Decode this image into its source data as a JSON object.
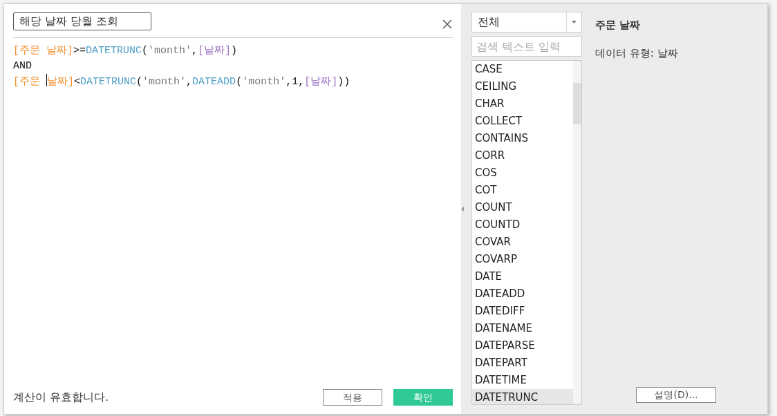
{
  "calc_name": {
    "value": "해당 날짜 당월 조회"
  },
  "formula_lines": [
    [
      {
        "kind": "field",
        "text": "[주문 날짜]"
      },
      {
        "kind": "plain",
        "text": ">="
      },
      {
        "kind": "func",
        "text": "DATETRUNC"
      },
      {
        "kind": "plain",
        "text": "("
      },
      {
        "kind": "string",
        "text": "'month'"
      },
      {
        "kind": "plain",
        "text": ","
      },
      {
        "kind": "param",
        "text": "[날짜]"
      },
      {
        "kind": "plain",
        "text": ")"
      }
    ],
    [
      {
        "kind": "plain",
        "text": "AND"
      }
    ],
    [
      {
        "kind": "field",
        "text": "[주문 "
      },
      {
        "kind": "field",
        "text": "날짜]",
        "caret_before": true
      },
      {
        "kind": "plain",
        "text": "<"
      },
      {
        "kind": "func",
        "text": "DATETRUNC"
      },
      {
        "kind": "plain",
        "text": "("
      },
      {
        "kind": "string",
        "text": "'month'"
      },
      {
        "kind": "plain",
        "text": ","
      },
      {
        "kind": "func",
        "text": "DATEADD"
      },
      {
        "kind": "plain",
        "text": "("
      },
      {
        "kind": "string",
        "text": "'month'"
      },
      {
        "kind": "plain",
        "text": ",1,"
      },
      {
        "kind": "param",
        "text": "[날짜]"
      },
      {
        "kind": "plain",
        "text": "))"
      }
    ]
  ],
  "status": "계산이 유효합니다.",
  "buttons": [
    {
      "kind": "secondary",
      "label": "적용"
    },
    {
      "kind": "primary",
      "label": "확인"
    }
  ],
  "category_select": {
    "value": "전체"
  },
  "function_search": {
    "placeholder": "검색 텍스트 입력"
  },
  "functions": [
    {
      "name": "CASE",
      "selected": false
    },
    {
      "name": "CEILING",
      "selected": false
    },
    {
      "name": "CHAR",
      "selected": false
    },
    {
      "name": "COLLECT",
      "selected": false
    },
    {
      "name": "CONTAINS",
      "selected": false
    },
    {
      "name": "CORR",
      "selected": false
    },
    {
      "name": "COS",
      "selected": false
    },
    {
      "name": "COT",
      "selected": false
    },
    {
      "name": "COUNT",
      "selected": false
    },
    {
      "name": "COUNTD",
      "selected": false
    },
    {
      "name": "COVAR",
      "selected": false
    },
    {
      "name": "COVARP",
      "selected": false
    },
    {
      "name": "DATE",
      "selected": false
    },
    {
      "name": "DATEADD",
      "selected": false
    },
    {
      "name": "DATEDIFF",
      "selected": false
    },
    {
      "name": "DATENAME",
      "selected": false
    },
    {
      "name": "DATEPARSE",
      "selected": false
    },
    {
      "name": "DATEPART",
      "selected": false
    },
    {
      "name": "DATETIME",
      "selected": false
    },
    {
      "name": "DATETRUNC",
      "selected": true
    }
  ],
  "info": {
    "title": "주문 날짜",
    "description": "데이터 유형: 날짜"
  },
  "explain_button": {
    "label": "설명(D)..."
  }
}
